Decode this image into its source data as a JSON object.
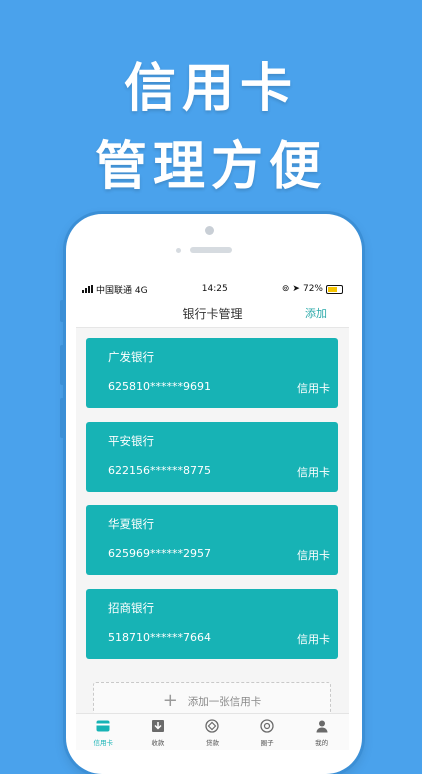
{
  "promo": {
    "line1": "信用卡",
    "line2": "管理方便"
  },
  "status_bar": {
    "carrier": "中国联通 4G",
    "time": "14:25",
    "battery": "72%"
  },
  "nav": {
    "title": "银行卡管理",
    "action": "添加"
  },
  "cards": [
    {
      "bank": "广发银行",
      "number": "625810******9691",
      "type": "信用卡"
    },
    {
      "bank": "平安银行",
      "number": "622156******8775",
      "type": "信用卡"
    },
    {
      "bank": "华夏银行",
      "number": "625969******2957",
      "type": "信用卡"
    },
    {
      "bank": "招商银行",
      "number": "518710******7664",
      "type": "信用卡"
    }
  ],
  "add_card_label": "添加一张信用卡",
  "tabs": [
    {
      "label": "信用卡",
      "icon": "card-icon",
      "active": true
    },
    {
      "label": "收款",
      "icon": "download-icon",
      "active": false
    },
    {
      "label": "贷款",
      "icon": "coin-icon",
      "active": false
    },
    {
      "label": "圈子",
      "icon": "circle-icon",
      "active": false
    },
    {
      "label": "我的",
      "icon": "user-icon",
      "active": false
    }
  ],
  "colors": {
    "background": "#4aa2ec",
    "card": "#17b3b5",
    "accent": "#2aa9a9"
  }
}
